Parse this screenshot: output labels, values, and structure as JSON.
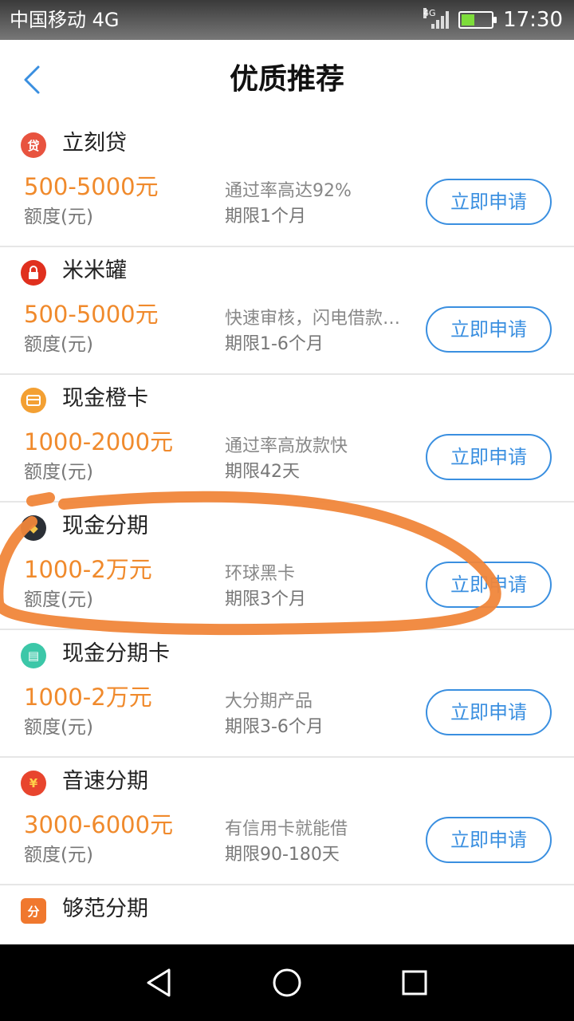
{
  "status_bar": {
    "carrier": "中国移动 4G",
    "network": "4G",
    "time": "17:30"
  },
  "header": {
    "title": "优质推荐"
  },
  "products": [
    {
      "name": "立刻贷",
      "icon": "loan-icon",
      "icon_text": "贷",
      "icon_color": "#e8533f",
      "amount": "500-5000元",
      "amount_label": "额度(元)",
      "desc": "通过率高达92%",
      "term": "期限1个月",
      "button": "立即申请"
    },
    {
      "name": "米米罐",
      "icon": "lock-icon",
      "icon_text": "",
      "icon_color": "#e0301e",
      "amount": "500-5000元",
      "amount_label": "额度(元)",
      "desc": "快速审核，闪电借款…",
      "term": "期限1-6个月",
      "button": "立即申请"
    },
    {
      "name": "现金橙卡",
      "icon": "card-icon",
      "icon_text": "",
      "icon_color": "#f3a033",
      "amount": "1000-2000元",
      "amount_label": "额度(元)",
      "desc": "通过率高放款快",
      "term": "期限42天",
      "button": "立即申请"
    },
    {
      "name": "现金分期",
      "icon": "diamond-icon",
      "icon_text": "◆",
      "icon_color": "#2b2f36",
      "amount": "1000-2万元",
      "amount_label": "额度(元)",
      "desc": "环球黑卡",
      "term": "期限3个月",
      "button": "立即申请"
    },
    {
      "name": "现金分期卡",
      "icon": "wallet-icon",
      "icon_text": "▤",
      "icon_color": "#3cc7a8",
      "amount": "1000-2万元",
      "amount_label": "额度(元)",
      "desc": "大分期产品",
      "term": "期限3-6个月",
      "button": "立即申请"
    },
    {
      "name": "音速分期",
      "icon": "coin-icon",
      "icon_text": "¥",
      "icon_color": "#e8452e",
      "amount": "3000-6000元",
      "amount_label": "额度(元)",
      "desc": "有信用卡就能借",
      "term": "期限90-180天",
      "button": "立即申请"
    },
    {
      "name": "够范分期",
      "icon": "gouf-icon",
      "icon_text": "分",
      "icon_color": "#f0782e",
      "amount": "",
      "amount_label": "",
      "desc": "",
      "term": "",
      "button": ""
    }
  ],
  "colors": {
    "accent": "#3a8fe0",
    "amount": "#f08a2c",
    "annotation": "#f0863a"
  }
}
